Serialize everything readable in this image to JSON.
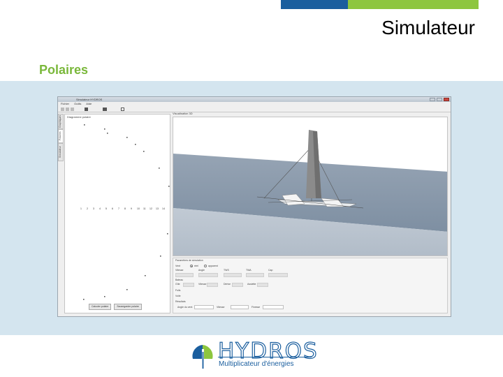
{
  "slide": {
    "title": "Simulateur",
    "section": "Polaires"
  },
  "colors": {
    "brand_blue": "#1a5e9e",
    "brand_green": "#8dc63f",
    "section_green": "#7ab83b",
    "band": "#d4e5ef",
    "water": "#8d9cad"
  },
  "app": {
    "window_title": "Simulateur HYDROS",
    "menu": [
      "Fichier",
      "Outils",
      "Aide"
    ],
    "side_tabs": [
      "Simulateur",
      "Polaires",
      "Graphiques"
    ],
    "polar_panel_label": "Diagramme polaire",
    "polar_scale_labels": [
      "1",
      "2",
      "3",
      "4",
      "5",
      "6",
      "7",
      "8",
      "9",
      "10",
      "11",
      "12",
      "13",
      "14"
    ],
    "polar_buttons": [
      "Calculer polaire",
      "Sauvegarder polaire"
    ],
    "view_label": "Visualisation 3D",
    "params": {
      "header": "Paramètres de simulation",
      "wind_label": "Vent",
      "radio_true": "réel",
      "radio_apparent": "apparent",
      "fields_row1": [
        "Vitesse",
        "Angle",
        "TWS",
        "TWA",
        "Cap"
      ],
      "section2": "Bateau",
      "fields_row2": [
        "Gîte",
        "Vitesse",
        "Dérive",
        "Assiette"
      ],
      "section3": "Foils",
      "section4": "Voile",
      "section5": "Résultats",
      "fields_row5": [
        "Angle du vent",
        "Vitesse",
        "Finesse"
      ]
    }
  },
  "logo": {
    "name": "HYDROS",
    "tagline": "Multiplicateur d'énergies"
  }
}
